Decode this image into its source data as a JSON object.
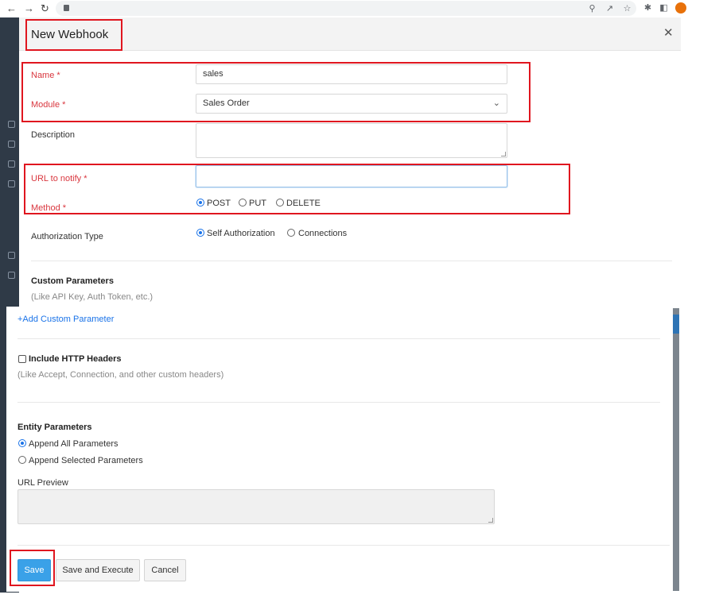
{
  "dialog": {
    "title": "New Webhook"
  },
  "form": {
    "name": {
      "label": "Name *",
      "value": "sales"
    },
    "module": {
      "label": "Module *",
      "value": "Sales Order"
    },
    "description": {
      "label": "Description",
      "value": ""
    },
    "url": {
      "label": "URL to notify *",
      "value": ""
    },
    "method": {
      "label": "Method *",
      "options": [
        "POST",
        "PUT",
        "DELETE"
      ],
      "selected": "POST"
    },
    "auth": {
      "label": "Authorization Type",
      "options": [
        "Self Authorization",
        "Connections"
      ],
      "selected": "Self Authorization"
    }
  },
  "custom_params": {
    "title": "Custom Parameters",
    "hint": "(Like API Key, Auth Token, etc.)",
    "add_link": "+Add Custom Parameter"
  },
  "headers": {
    "label": "Include HTTP Headers",
    "checked": false,
    "hint": "(Like Accept, Connection, and other custom headers)"
  },
  "entity": {
    "title": "Entity Parameters",
    "options": [
      "Append All Parameters",
      "Append Selected Parameters"
    ],
    "selected": "Append All Parameters",
    "preview_label": "URL Preview"
  },
  "footer": {
    "save": "Save",
    "save_execute": "Save and Execute",
    "cancel": "Cancel"
  },
  "colors": {
    "required": "#d9363e",
    "primary": "#3aa1e8",
    "link": "#1a73e8",
    "highlight": "#e0161f"
  }
}
